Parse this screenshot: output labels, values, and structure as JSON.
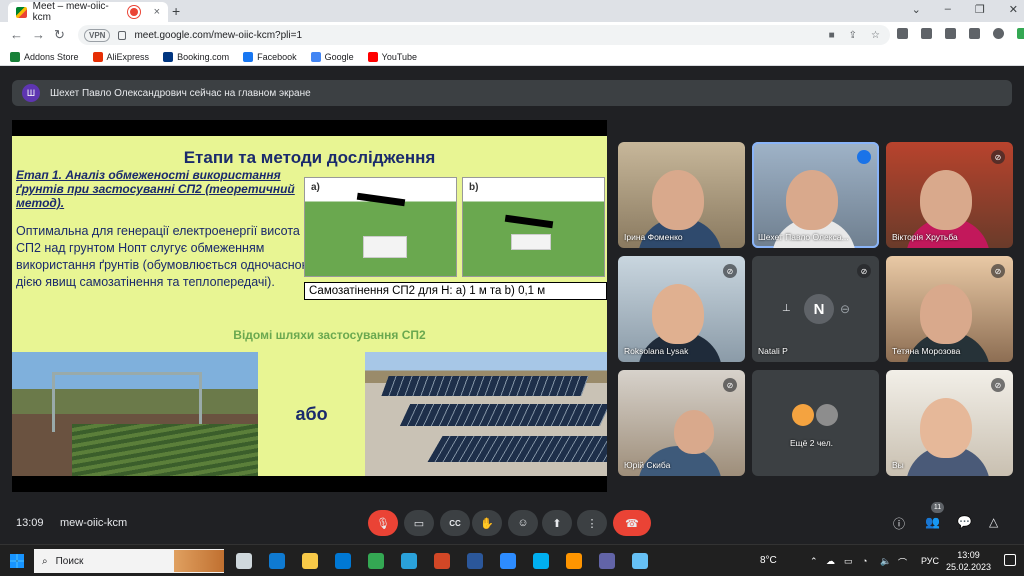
{
  "browser": {
    "tab_title": "Meet – mew-oiic-kcm",
    "tab_close": "×",
    "new_tab": "+",
    "window_controls": [
      "⌄",
      "–",
      "❐",
      "✕"
    ],
    "nav": {
      "back": "←",
      "forward": "→",
      "reload": "↻"
    },
    "vpn_label": "VPN",
    "url": "meet.google.com/mew-oiic-kcm?pli=1",
    "bookmarks": [
      {
        "label": "Addons Store",
        "color": "#188038"
      },
      {
        "label": "AliExpress",
        "color": "#e62e04"
      },
      {
        "label": "Booking.com",
        "color": "#003580"
      },
      {
        "label": "Facebook",
        "color": "#1877f2"
      },
      {
        "label": "Google",
        "color": "#4285f4"
      },
      {
        "label": "YouTube",
        "color": "#ff0000"
      }
    ]
  },
  "meet": {
    "banner": {
      "avatar_letter": "Ш",
      "text": "Шехет Павло Олександрович сейчас на главном экране"
    },
    "slide": {
      "title": "Етапи та методи дослідження",
      "stage": "Етап 1. Аналіз обмеженості використання ґрунтів при застосуванні СП2 (теоретичний метод).",
      "optimal_text": "Оптимальна для генерації електроенергії висота СП2 над грунтом Hопт слугує обмеженням використання ґрунтів (обумовлюється одночасною дією явищ самозатінення та теплопередачі).",
      "img_a_label": "a)",
      "img_b_label": "b)",
      "caption": "Самозатінення СП2 для H: a) 1 м та b) 0,1 м",
      "known_paths": "Відомі шляхи застосування СП2",
      "or": "або"
    },
    "tiles": [
      {
        "name": "Ірина Фоменко",
        "status": ""
      },
      {
        "name": "Шехет Павло Олекса...",
        "status": "speaking"
      },
      {
        "name": "Вікторія Хрутьба",
        "status": "muted"
      },
      {
        "name": "Roksolana Lysak",
        "status": "muted"
      },
      {
        "name": "Natali P",
        "status": "muted",
        "avatar_letter": "N"
      },
      {
        "name": "Тетяна Морозова",
        "status": "muted"
      },
      {
        "name": "Юрій Скиба",
        "status": "muted"
      },
      {
        "name": "Ещё 2 чел.",
        "status": ""
      },
      {
        "name": "Вы",
        "status": "muted"
      }
    ],
    "controls": {
      "time": "13:09",
      "meeting_code": "mew-oiic-kcm",
      "participant_count": "11",
      "buttons": {
        "mic": "🎙",
        "camera": "▭",
        "captions": "CC",
        "raise_hand": "✋",
        "emoji": "☺",
        "present": "⬆",
        "more": "⋮",
        "end_call": "☎",
        "info": "ⓘ",
        "people": "👥",
        "chat": "💬",
        "activities": "△"
      }
    }
  },
  "taskbar": {
    "search_label": "Поиск",
    "weather": "8°C",
    "lang": "РУС",
    "time": "13:09",
    "date": "25.02.2023",
    "apps": [
      {
        "name": "task-view",
        "color": "#cfd8dc"
      },
      {
        "name": "edge",
        "color": "#0f7ad1"
      },
      {
        "name": "explorer",
        "color": "#f7c948"
      },
      {
        "name": "mail",
        "color": "#0078d4"
      },
      {
        "name": "chrome",
        "color": "#34a853"
      },
      {
        "name": "telegram",
        "color": "#2aa1da"
      },
      {
        "name": "powerpoint",
        "color": "#d24726"
      },
      {
        "name": "word",
        "color": "#2b579a"
      },
      {
        "name": "zoom",
        "color": "#2d8cff"
      },
      {
        "name": "skype",
        "color": "#00aff0"
      },
      {
        "name": "firefox",
        "color": "#ff9500"
      },
      {
        "name": "teams",
        "color": "#6264a7"
      },
      {
        "name": "steam",
        "color": "#66c0f4"
      }
    ]
  }
}
